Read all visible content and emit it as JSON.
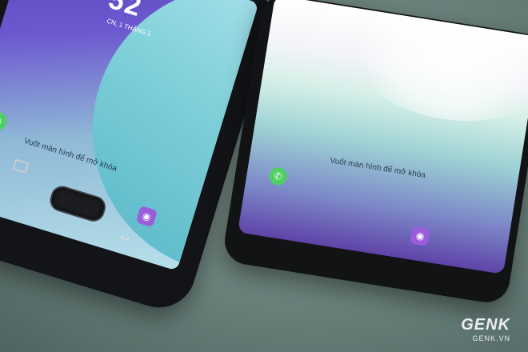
{
  "photo": {
    "left_phone": {
      "lock_time": "52",
      "lock_date": "CN, 1 THÁNG 1",
      "unlock_hint": "Vuốt màn hình để mở khóa"
    },
    "right_phone": {
      "unlock_hint": "Vuốt màn hình để mở khóa"
    },
    "watermark": {
      "logo_text": "GENK",
      "url": "GENK.VN"
    }
  },
  "icons": {
    "phone": "phone-icon",
    "camera": "camera-icon",
    "recent_apps": "recent-apps-icon",
    "back": "back-icon"
  }
}
